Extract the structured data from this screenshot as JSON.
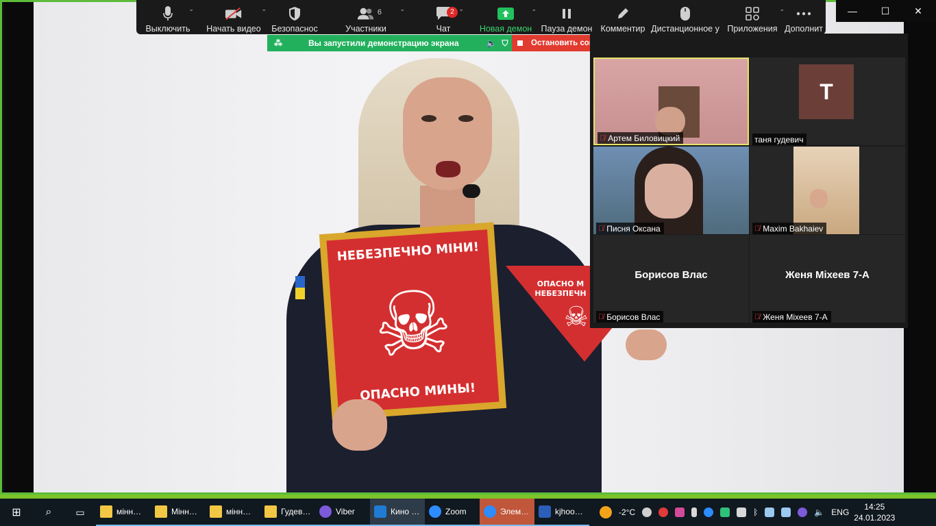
{
  "toolbar": {
    "mute": "Выключить",
    "video": "Начать видео",
    "security": "Безопаснос",
    "participants": "Участники",
    "participants_count": "6",
    "chat": "Чат",
    "chat_badge": "2",
    "new_share": "Новая демон",
    "pause_share": "Пауза демон",
    "annotate": "Комментир",
    "remote": "Дистанционное у",
    "apps": "Приложения",
    "more": "Дополнит"
  },
  "share_bar": {
    "status": "Вы запустили демонстрацию экрана",
    "stop": "Остановить совместное использование"
  },
  "presentation": {
    "sign_top": "НЕБЕЗПЕЧНО МІНИ!",
    "sign_bottom": "ОПАСНО МИНЫ!",
    "triangle_text": "ОПАСНО М НЕБЕЗПЕЧН"
  },
  "participants": [
    {
      "name": "Артем Биловицкий"
    },
    {
      "name": "таня гудевич",
      "initial": "T"
    },
    {
      "name": "Писня Оксана"
    },
    {
      "name": "Maxim Bakhaiev"
    },
    {
      "name": "Борисов Влас",
      "display": "Борисов Влас"
    },
    {
      "name": "Женя Міхеев 7-А",
      "display": "Женя Міхеев 7-А"
    }
  ],
  "taskbar": {
    "apps": [
      {
        "label": "мінн…"
      },
      {
        "label": "Мінн…"
      },
      {
        "label": "мінн…"
      },
      {
        "label": "Гудев…"
      },
      {
        "label": "Viber"
      },
      {
        "label": "Кино …"
      },
      {
        "label": "Zoom"
      },
      {
        "label": "Элем…"
      },
      {
        "label": "kjhoo…"
      }
    ],
    "weather": "-2°C",
    "language": "ENG",
    "time": "14:25",
    "date": "24.01.2023"
  },
  "colors": {
    "share_green": "#22b05d",
    "stop_red": "#e23b2f",
    "frame_green": "#5dbb3a",
    "speaker_highlight": "#e6e36a"
  }
}
